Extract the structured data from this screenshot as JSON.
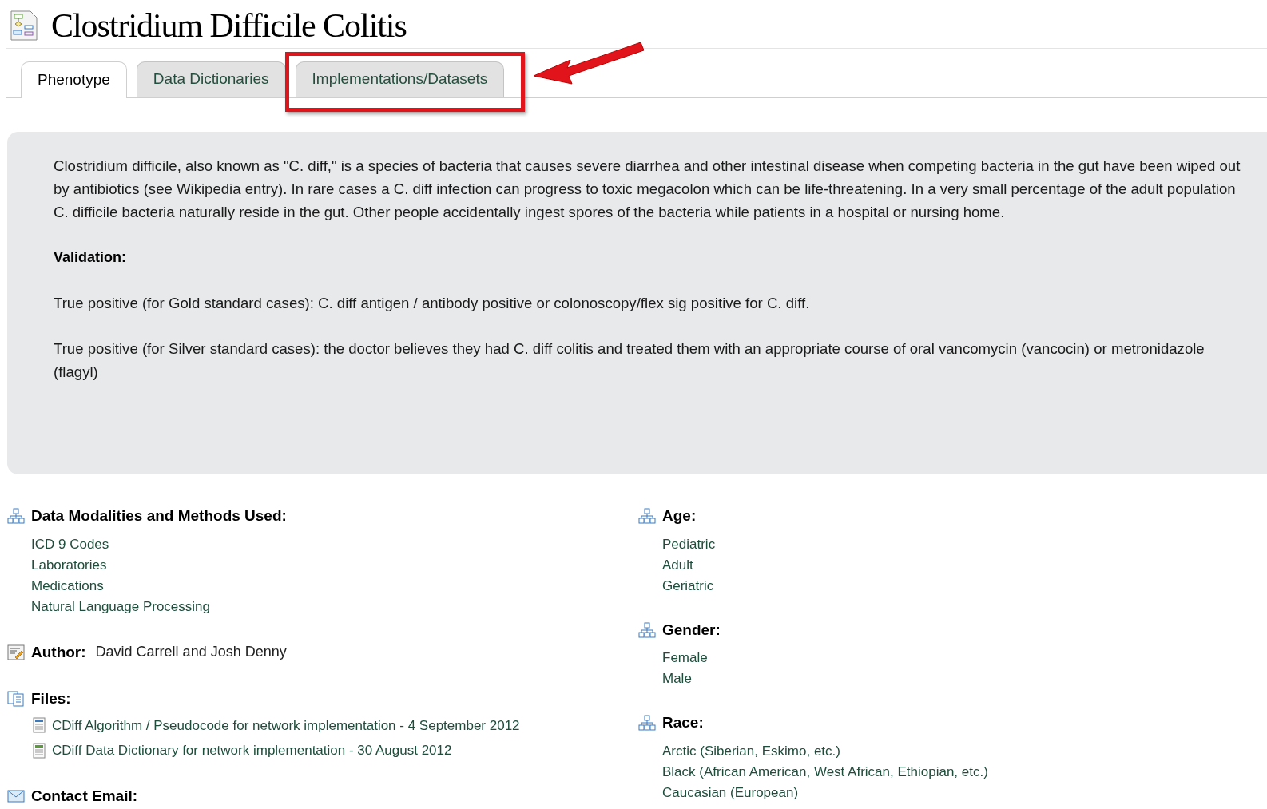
{
  "title": "Clostridium Difficile Colitis",
  "tabs": [
    {
      "label": "Phenotype",
      "selected": true
    },
    {
      "label": "Data Dictionaries",
      "selected": false
    },
    {
      "label": "Implementations/Datasets",
      "selected": false,
      "highlighted": true
    }
  ],
  "description": {
    "paragraphs": [
      {
        "kind": "text",
        "text": "Clostridium difficile, also known as \"C. diff,\" is a species of bacteria that causes severe diarrhea and other intestinal disease when competing bacteria in the gut have been wiped out by antibiotics (see Wikipedia entry). In rare cases a C. diff infection can progress to toxic megacolon which can be life-threatening. In a very small percentage of the adult population C. difficile bacteria naturally reside in the gut. Other people accidentally ingest spores of the bacteria while patients in a hospital or nursing home."
      },
      {
        "kind": "heading",
        "text": "Validation:"
      },
      {
        "kind": "text",
        "text": "True positive (for Gold standard cases): C. diff antigen / antibody positive or colonoscopy/flex sig positive for C. diff."
      },
      {
        "kind": "text",
        "text": "True positive (for Silver standard cases): the doctor believes they had C. diff colitis and treated them with an appropriate course of oral vancomycin (vancocin) or metronidazole (flagyl)"
      }
    ]
  },
  "left_sections": [
    {
      "kind": "list",
      "heading": "Data Modalities and Methods Used:",
      "items": [
        "ICD 9 Codes",
        "Laboratories",
        "Medications",
        "Natural Language Processing"
      ]
    },
    {
      "kind": "author",
      "heading": "Author:",
      "value": "David Carrell and Josh Denny"
    },
    {
      "kind": "files",
      "heading": "Files:",
      "items": [
        "CDiff Algorithm / Pseudocode for network implementation - 4 September 2012",
        "CDiff Data Dictionary for network implementation - 30 August 2012"
      ]
    },
    {
      "kind": "email",
      "heading": "Contact Email:"
    }
  ],
  "right_sections": [
    {
      "kind": "list",
      "heading": "Age:",
      "items": [
        "Pediatric",
        "Adult",
        "Geriatric"
      ]
    },
    {
      "kind": "list",
      "heading": "Gender:",
      "items": [
        "Female",
        "Male"
      ]
    },
    {
      "kind": "list",
      "heading": "Race:",
      "items": [
        "Arctic (Siberian, Eskimo, etc.)",
        "Black (African American, West African, Ethiopian, etc.)",
        "Caucasian (European)"
      ]
    }
  ]
}
